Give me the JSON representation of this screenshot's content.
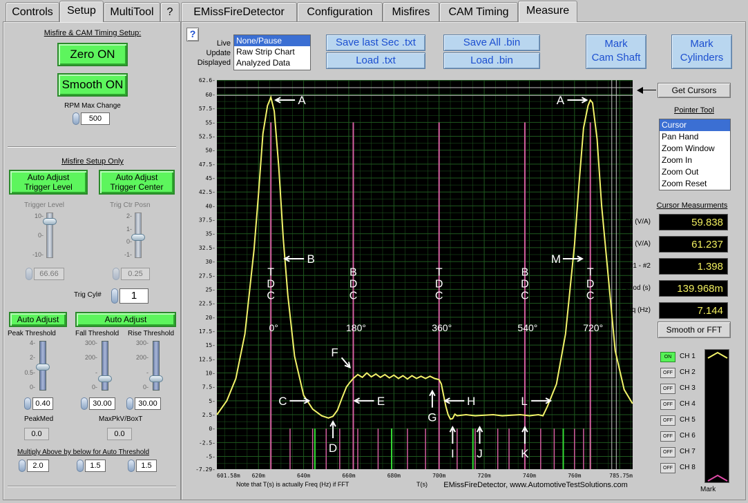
{
  "left_tabs": [
    "Controls",
    "Setup",
    "MultiTool",
    "?"
  ],
  "left_active_tab": "Setup",
  "right_tabs": [
    "EMissFireDetector",
    "Configuration",
    "Misfires",
    "CAM Timing",
    "Measure"
  ],
  "right_active_tab": "Measure",
  "setup": {
    "section_title": "Misfire & CAM Timing Setup:",
    "zero_btn": "Zero ON",
    "smooth_btn": "Smooth ON",
    "rpm_label": "RPM Max Change",
    "rpm_value": "500"
  },
  "misfire": {
    "section_title": "Misfire Setup Only",
    "auto_trigger_level": "Auto Adjust\nTrigger Level",
    "auto_trigger_center": "Auto Adjust\nTrigger Center",
    "trigger_level_label": "Trigger Level",
    "trig_ctr_label": "Trig Ctr Posn",
    "tl_ticks": [
      "10-",
      "0-",
      "-10-"
    ],
    "tc_ticks": [
      "2-",
      "1-",
      "0-",
      "-1-"
    ],
    "trigger_level_value": "66.66",
    "trigger_level_fraction": 0.85,
    "trig_ctr_value": "0.25",
    "trig_ctr_fraction": 0.35,
    "trig_cyl_label": "Trig Cyl#",
    "trig_cyl_value": "1",
    "auto_adjust_1": "Auto Adjust",
    "auto_adjust_2": "Auto Adjust",
    "peak_label": "Peak Threshold",
    "fall_label": "Fall Threshold",
    "rise_label": "Rise Threshold",
    "peak_ticks": [
      "4-",
      "2-",
      "0.5-",
      "0-"
    ],
    "fall_ticks": [
      "300-",
      "200-",
      "-",
      "0-"
    ],
    "rise_ticks": [
      "300-",
      "200-",
      "-",
      "0-"
    ],
    "peak_value": "0.40",
    "peak_fraction": 0.4,
    "fall_value": "30.00",
    "fall_fraction": 0.1,
    "rise_value": "30.00",
    "rise_fraction": 0.1,
    "peakmed_label": "PeakMed",
    "peakmed_value": "0.0",
    "maxpkv_label": "MaxPkV/BoxT",
    "maxpkv_value": "0.0",
    "multiply_label": "Multiply Above by below for Auto Threshold",
    "mult_1": "2.0",
    "mult_2": "1.5",
    "mult_3": "1.5"
  },
  "toolbar": {
    "help": "?",
    "live_lines": [
      "Live",
      "Update",
      "Displayed"
    ],
    "display_options": [
      "None/Pause",
      "Raw Strip Chart",
      "Analyzed Data"
    ],
    "display_selected": 0,
    "save_last": "Save last Sec .txt",
    "load_txt": "Load .txt",
    "save_all": "Save All .bin",
    "load_bin": "Load .bin",
    "mark_cam": "Mark\nCam Shaft",
    "mark_cyl": "Mark\nCylinders"
  },
  "right_panel": {
    "get_cursors": "Get Cursors",
    "pointer_title": "Pointer Tool",
    "pointer_items": [
      "Cursor",
      "Pan Hand",
      "Zoom Window",
      "Zoom In",
      "Zoom Out",
      "Zoom Reset"
    ],
    "pointer_selected": 0,
    "cursor_title": "Cursor Measurments",
    "measurements": [
      {
        "label": "#1 (V/A)",
        "value": "59.838"
      },
      {
        "label": "#2 (V/A)",
        "value": "61.237"
      },
      {
        "label": "#1 - #2",
        "value": "1.398"
      },
      {
        "label": "Period (s)",
        "value": "139.968m"
      },
      {
        "label": "Freq (Hz)",
        "value": "7.144"
      }
    ],
    "smooth_fft": "Smooth or FFT",
    "channels": [
      {
        "state": "ON",
        "name": "CH 1"
      },
      {
        "state": "OFF",
        "name": "CH 2"
      },
      {
        "state": "OFF",
        "name": "CH 3"
      },
      {
        "state": "OFF",
        "name": "CH 4"
      },
      {
        "state": "OFF",
        "name": "CH 5"
      },
      {
        "state": "OFF",
        "name": "CH 6"
      },
      {
        "state": "OFF",
        "name": "CH 7"
      },
      {
        "state": "OFF",
        "name": "CH 8"
      }
    ],
    "mark_label": "Mark"
  },
  "chart_data": {
    "type": "line",
    "ylim": [
      -7.29,
      62.6
    ],
    "y_ticks": [
      62.6,
      60,
      57.5,
      55,
      52.5,
      50,
      47.5,
      45,
      42.5,
      40,
      37.5,
      35,
      32.5,
      30,
      27.5,
      25,
      22.5,
      20,
      17.5,
      15,
      12.5,
      10,
      7.5,
      5,
      2.5,
      0,
      -2.5,
      -5,
      -7.29
    ],
    "y_tick_labels": [
      "62.6-",
      "60-",
      "57.5-",
      "55-",
      "52.5-",
      "50-",
      "47.5-",
      "45-",
      "42.5-",
      "40-",
      "37.5-",
      "35-",
      "32.5-",
      "30-",
      "27.5-",
      "25-",
      "22.5-",
      "20-",
      "17.5-",
      "15-",
      "12.5-",
      "10-",
      "7.5-",
      "5-",
      "2.5-",
      "0-",
      "-2.5-",
      "-5-",
      "-7.29-"
    ],
    "xlim": [
      601.58,
      785.75
    ],
    "x_ticks": [
      601.58,
      620,
      640,
      660,
      680,
      700,
      720,
      740,
      760,
      785.75
    ],
    "x_tick_labels": [
      "601.58m",
      "620m",
      "640m",
      "660m",
      "680m",
      "700m",
      "720m",
      "740m",
      "760m",
      "785.75m"
    ],
    "xlabel": "T(s)",
    "x_note": "Note that T(s) is actually Freq (Hz) if FFT",
    "footer": "EMissFireDetector, www.AutomotiveTestSolutions.com",
    "x": [
      601.6,
      606,
      610,
      614,
      618,
      620,
      622,
      624,
      625.5,
      627,
      629,
      631,
      633,
      636,
      640,
      644,
      648,
      651,
      653,
      655,
      657,
      659,
      660.5,
      662,
      664,
      666,
      668,
      670,
      672,
      674,
      676,
      678,
      680,
      682,
      684,
      686,
      688,
      690,
      692,
      694,
      696,
      698,
      700,
      701,
      702,
      703,
      704,
      705,
      706,
      707,
      708,
      710,
      712,
      716,
      720,
      724,
      728,
      732,
      736,
      740,
      742,
      744,
      746,
      748,
      752,
      756,
      760,
      762,
      764,
      766,
      767,
      768,
      770,
      772,
      775,
      778,
      782,
      785.7
    ],
    "y": [
      2.5,
      5,
      9,
      17,
      32,
      42,
      53,
      58,
      59.5,
      57,
      47,
      34,
      24,
      13,
      6,
      3.5,
      2.3,
      1.9,
      2.2,
      3.3,
      5.5,
      7.5,
      8.3,
      9,
      9.7,
      9.2,
      10,
      9.3,
      9.8,
      9.2,
      9.7,
      9.1,
      9.6,
      9,
      9.5,
      8.9,
      9.5,
      9,
      9.4,
      9,
      9.4,
      9,
      8.8,
      8,
      6,
      4,
      2.5,
      1.7,
      1.8,
      2.6,
      2.3,
      2.4,
      2.5,
      2.3,
      2.4,
      2.5,
      2.3,
      2.4,
      2.5,
      2.3,
      2.4,
      2.5,
      2.3,
      4,
      8,
      17,
      33,
      44,
      54,
      58,
      59,
      58.5,
      52,
      40,
      27,
      14,
      7,
      4.5
    ],
    "tdc_lines": [
      625.5,
      662,
      700,
      738,
      767
    ],
    "tdc_labels": [
      {
        "x": 625.5,
        "letters": [
          "T",
          "D",
          "C"
        ],
        "deg": "0°"
      },
      {
        "x": 662,
        "letters": [
          "B",
          "D",
          "C"
        ],
        "deg": "180°"
      },
      {
        "x": 700,
        "letters": [
          "T",
          "D",
          "C"
        ],
        "deg": "360°"
      },
      {
        "x": 738,
        "letters": [
          "B",
          "D",
          "C"
        ],
        "deg": "540°"
      },
      {
        "x": 767,
        "letters": [
          "T",
          "D",
          "C"
        ],
        "deg": "720°"
      }
    ],
    "marker_lines_pink": [
      634,
      644,
      650,
      656,
      664,
      673,
      679,
      686,
      694,
      708,
      716,
      726,
      731,
      745,
      751,
      760,
      764
    ],
    "marker_lines_green": [
      645,
      679,
      715,
      755,
      767
    ],
    "annotations": [
      {
        "text": "A",
        "x": 627,
        "y": 59,
        "dir": "left"
      },
      {
        "text": "A",
        "x": 766,
        "y": 59,
        "dir": "right"
      },
      {
        "text": "B",
        "x": 631,
        "y": 30.5,
        "dir": "left"
      },
      {
        "text": "M",
        "x": 764,
        "y": 30.5,
        "dir": "right"
      },
      {
        "text": "C",
        "x": 643,
        "y": 5,
        "dir": "right"
      },
      {
        "text": "E",
        "x": 662,
        "y": 5,
        "dir": "left"
      },
      {
        "text": "F",
        "x": 660.5,
        "y": 11,
        "dir": "downright"
      },
      {
        "text": "G",
        "x": 697,
        "y": 7,
        "dir": "up"
      },
      {
        "text": "H",
        "x": 702,
        "y": 5,
        "dir": "left"
      },
      {
        "text": "L",
        "x": 750,
        "y": 5,
        "dir": "right"
      },
      {
        "text": "D",
        "x": 653,
        "y": 1.5,
        "dir": "up"
      },
      {
        "text": "I",
        "x": 706,
        "y": 0.5,
        "dir": "up"
      },
      {
        "text": "J",
        "x": 718,
        "y": 0.5,
        "dir": "up"
      },
      {
        "text": "K",
        "x": 738,
        "y": 0.5,
        "dir": "up"
      }
    ],
    "cursor_lines": [
      776.5,
      778.5
    ],
    "cursor_hlines": [
      59.838,
      61.237
    ],
    "colors": {
      "background": "#000000",
      "grid": "#1f5a1f",
      "trace": "#f3f36a",
      "tdc": "#d45fa0",
      "marker_green": "#33dd33",
      "cursor": "#c8c8c8"
    }
  }
}
